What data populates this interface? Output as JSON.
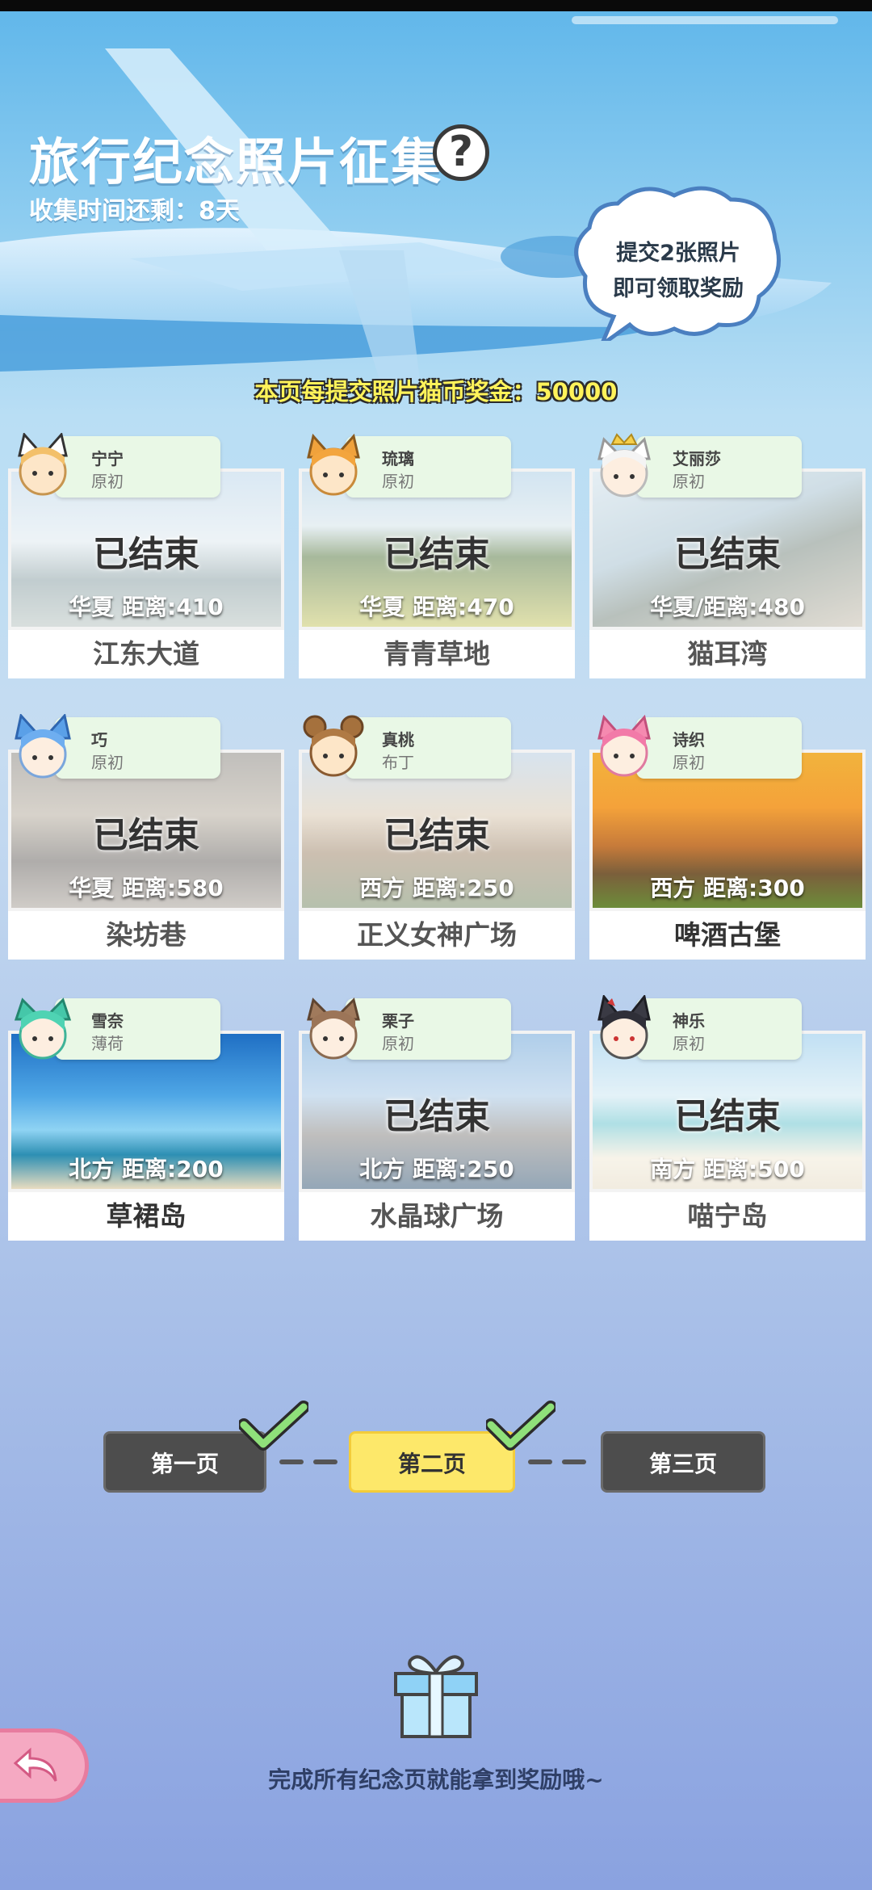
{
  "header": {
    "title": "旅行纪念照片征集",
    "help_symbol": "?",
    "remaining": "收集时间还剩：8天",
    "bubble_line1": "提交2张照片",
    "bubble_line2": "即可领取奖励",
    "bonus_line": "本页每提交照片猫币奖金：50000"
  },
  "cards": [
    {
      "char": "宁宁",
      "sub": "原初",
      "status": "已结束",
      "dist": "华夏  距离:410",
      "name": "江东大道"
    },
    {
      "char": "琉璃",
      "sub": "原初",
      "status": "已结束",
      "dist": "华夏  距离:470",
      "name": "青青草地"
    },
    {
      "char": "艾丽莎",
      "sub": "原初",
      "status": "已结束",
      "dist": "华夏/距离:480",
      "name": "猫耳湾"
    },
    {
      "char": "巧",
      "sub": "原初",
      "status": "已结束",
      "dist": "华夏  距离:580",
      "name": "染坊巷"
    },
    {
      "char": "真桃",
      "sub": "布丁",
      "status": "已结束",
      "dist": "西方  距离:250",
      "name": "正义女神广场"
    },
    {
      "char": "诗织",
      "sub": "原初",
      "status": "",
      "dist": "西方  距离:300",
      "name": "啤酒古堡"
    },
    {
      "char": "雪奈",
      "sub": "薄荷",
      "status": "",
      "dist": "北方  距离:200",
      "name": "草裙岛"
    },
    {
      "char": "栗子",
      "sub": "原初",
      "status": "已结束",
      "dist": "北方  距离:250",
      "name": "水晶球广场"
    },
    {
      "char": "神乐",
      "sub": "原初",
      "status": "已结束",
      "dist": "南方  距离:500",
      "name": "喵宁岛"
    }
  ],
  "pagination": {
    "page1": "第一页",
    "page2": "第二页",
    "page3": "第三页",
    "active": "第二页"
  },
  "footer": {
    "text": "完成所有纪念页就能拿到奖励哦~"
  },
  "colors": {
    "tag_bg": "#e9f8e6",
    "active_page": "#fde86a",
    "inactive_page": "#4d4d4d",
    "bonus_text": "#fff35a"
  }
}
